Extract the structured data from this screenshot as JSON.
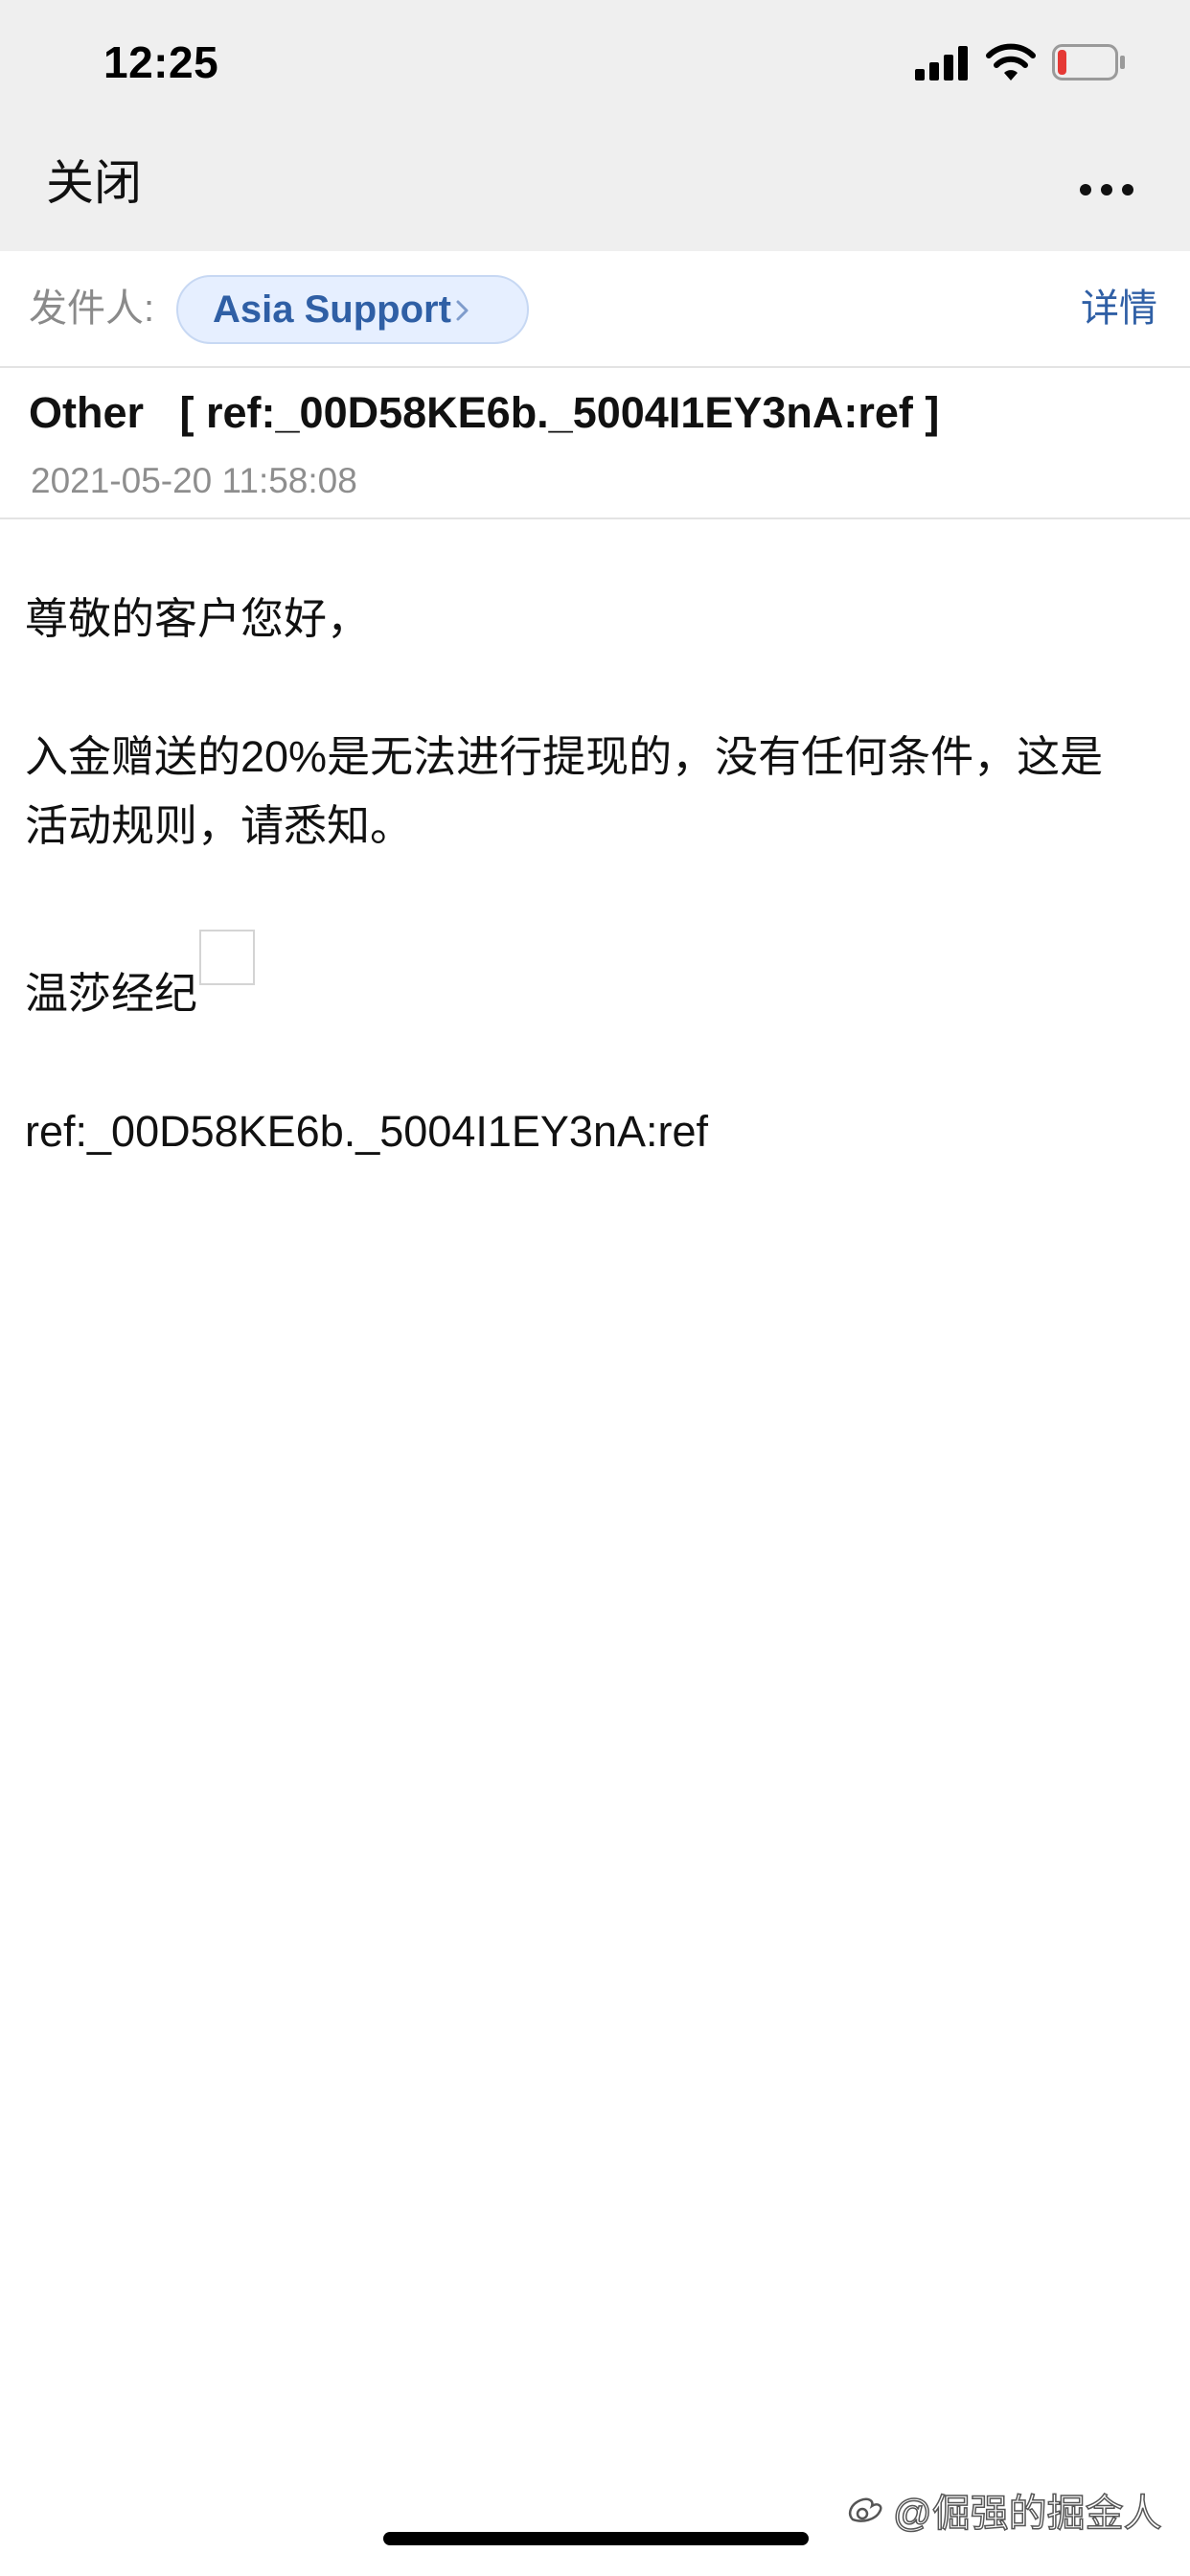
{
  "status_bar": {
    "time": "12:25",
    "icons": [
      "cellular-signal-icon",
      "wifi-icon",
      "battery-low-icon"
    ],
    "battery_level": 0.15,
    "battery_color": "#e53935"
  },
  "nav": {
    "close_label": "关闭",
    "more_icon": "more-horizontal-icon"
  },
  "sender": {
    "label": "发件人:",
    "name": "Asia Support",
    "details_label": "详情"
  },
  "message": {
    "subject": "Other   [ ref:_00D58KE6b._5004I1EY3nA:ref ]",
    "date": "2021-05-20 11:58:08",
    "greeting": "尊敬的客户您好，",
    "body": "入金赠送的20%是无法进行提现的，没有任何条件，这是活动规则，请悉知。",
    "signature": "温莎经纪",
    "ref": "ref:_00D58KE6b._5004I1EY3nA:ref"
  },
  "watermark": {
    "text": "@倔强的掘金人"
  },
  "colors": {
    "accent": "#2f5fa5",
    "top_bar_bg": "#efefef",
    "chip_bg": "#e6efff"
  }
}
